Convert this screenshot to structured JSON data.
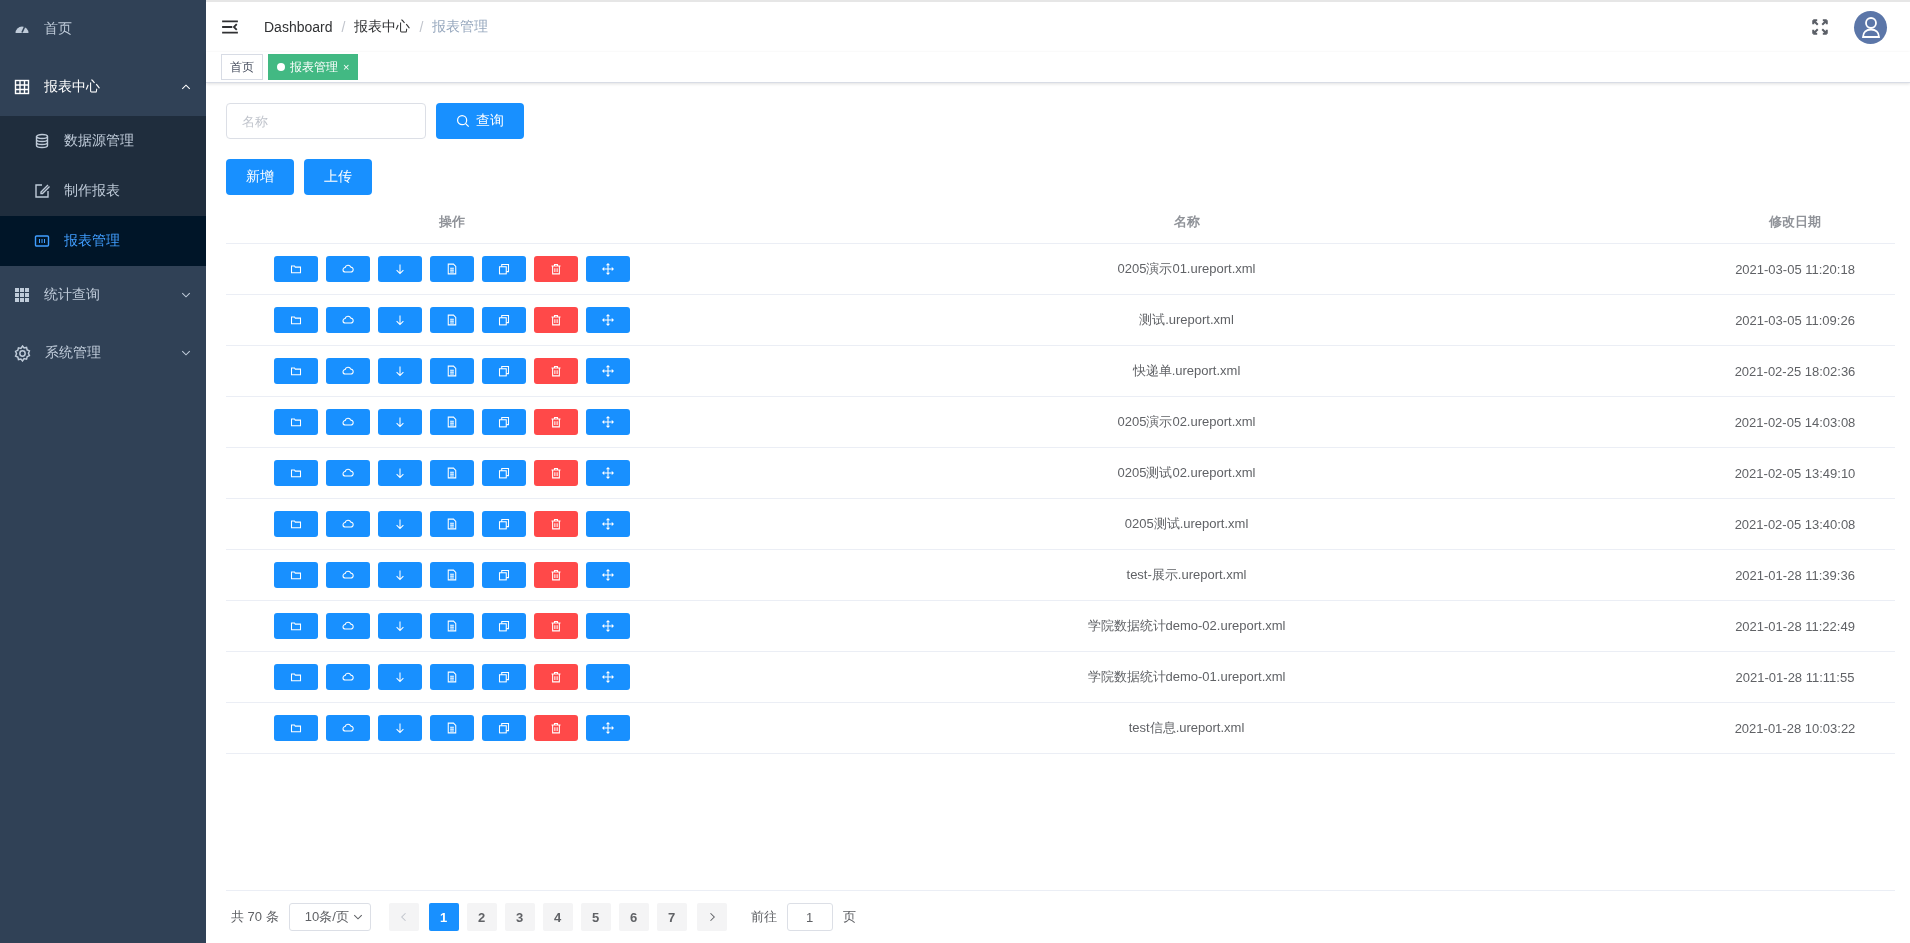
{
  "sidebar": {
    "items": [
      {
        "label": "首页",
        "kind": "dashboard",
        "selected": false
      },
      {
        "label": "报表中心",
        "kind": "table",
        "selected": false,
        "expanded": true,
        "children": [
          {
            "label": "数据源管理",
            "kind": "database",
            "selected": false
          },
          {
            "label": "制作报表",
            "kind": "edit",
            "selected": false
          },
          {
            "label": "报表管理",
            "kind": "monitor",
            "selected": true
          }
        ]
      },
      {
        "label": "统计查询",
        "kind": "grid",
        "selected": false,
        "expanded": false
      },
      {
        "label": "系统管理",
        "kind": "gear",
        "selected": false,
        "expanded": false
      }
    ]
  },
  "breadcrumb": [
    {
      "kind": "link",
      "text": "Dashboard"
    },
    {
      "kind": "separator",
      "text": "/"
    },
    {
      "kind": "link",
      "text": "报表中心"
    },
    {
      "kind": "separator",
      "text": "/"
    },
    {
      "kind": "current",
      "text": "报表管理"
    }
  ],
  "tags": [
    {
      "label": "首页",
      "selected": false
    },
    {
      "label": "报表管理",
      "selected": true,
      "close": "×"
    }
  ],
  "search": {
    "placeholder": "名称",
    "button": "查询"
  },
  "toolbar": [
    "新增",
    "上传"
  ],
  "table": {
    "columns": [
      "操作",
      "名称",
      "修改日期"
    ],
    "actions": [
      {
        "kind": "open"
      },
      {
        "kind": "upload"
      },
      {
        "kind": "download"
      },
      {
        "kind": "view"
      },
      {
        "kind": "copy"
      },
      {
        "kind": "delete"
      },
      {
        "kind": "move"
      }
    ],
    "rows": [
      {
        "name": "0205演示01.ureport.xml",
        "date": "2021-03-05 11:20:18"
      },
      {
        "name": "测试.ureport.xml",
        "date": "2021-03-05 11:09:26"
      },
      {
        "name": "快递单.ureport.xml",
        "date": "2021-02-25 18:02:36"
      },
      {
        "name": "0205演示02.ureport.xml",
        "date": "2021-02-05 14:03:08"
      },
      {
        "name": "0205测试02.ureport.xml",
        "date": "2021-02-05 13:49:10"
      },
      {
        "name": "0205测试.ureport.xml",
        "date": "2021-02-05 13:40:08"
      },
      {
        "name": "test-展示.ureport.xml",
        "date": "2021-01-28 11:39:36"
      },
      {
        "name": "学院数据统计demo-02.ureport.xml",
        "date": "2021-01-28 11:22:49"
      },
      {
        "name": "学院数据统计demo-01.ureport.xml",
        "date": "2021-01-28 11:11:55"
      },
      {
        "name": "test信息.ureport.xml",
        "date": "2021-01-28 10:03:22"
      }
    ]
  },
  "pagination": {
    "total": "共 70 条",
    "page_size": "10条/页",
    "pages": [
      {
        "label": "1",
        "selected": true
      },
      {
        "label": "2",
        "selected": false
      },
      {
        "label": "3",
        "selected": false
      },
      {
        "label": "4",
        "selected": false
      },
      {
        "label": "5",
        "selected": false
      },
      {
        "label": "6",
        "selected": false
      },
      {
        "label": "7",
        "selected": false
      }
    ],
    "goto_label": "前往",
    "goto_value": "1",
    "goto_unit": "页"
  }
}
